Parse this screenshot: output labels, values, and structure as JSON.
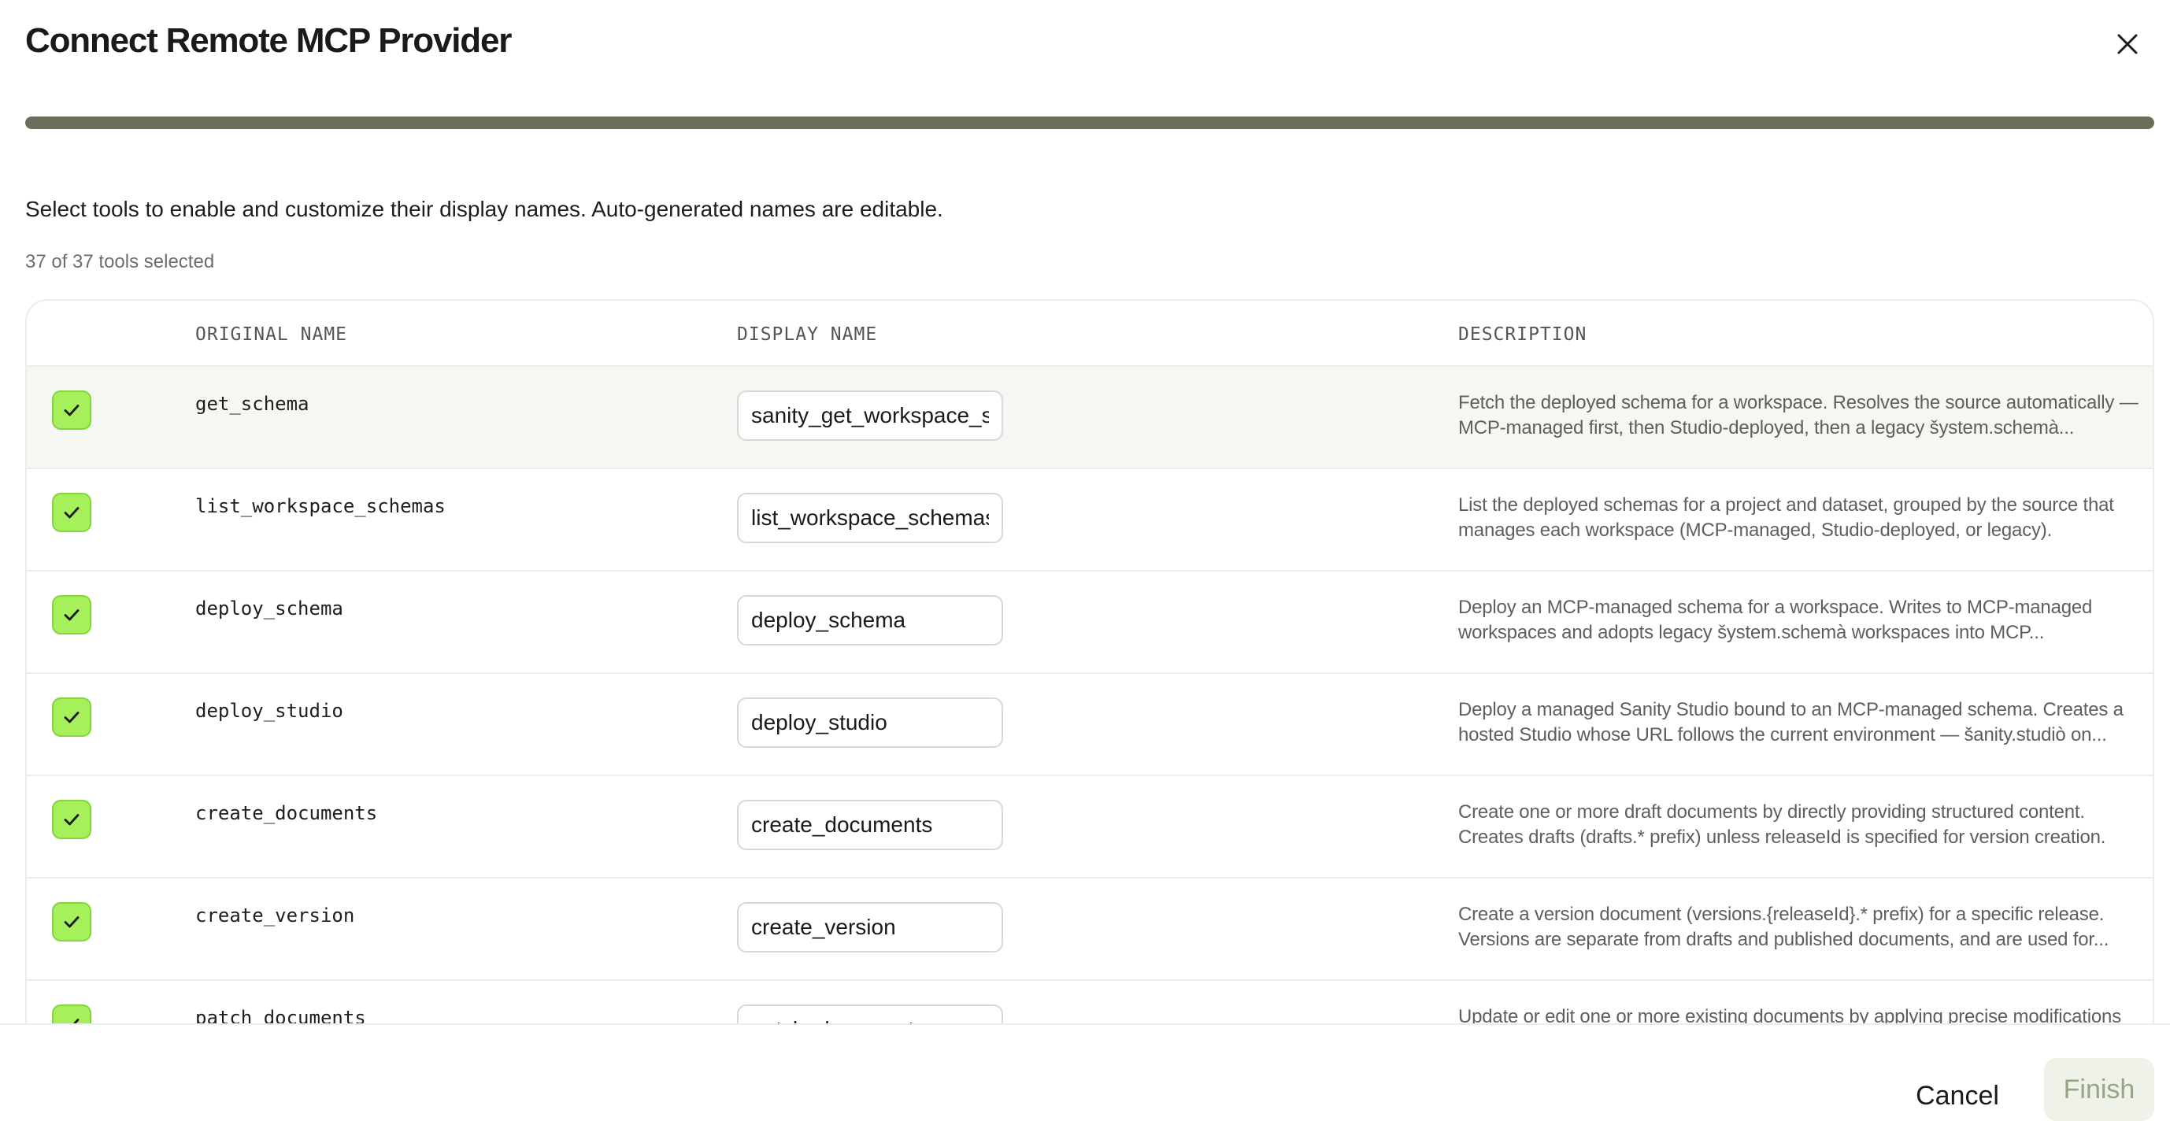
{
  "dialog": {
    "title": "Connect Remote MCP Provider",
    "close_icon": "close-icon",
    "progress_percent": 100,
    "subtitle": "Select tools to enable and customize their display names. Auto-generated names are editable.",
    "count_text": "37 of 37 tools selected"
  },
  "table": {
    "headers": {
      "original": "ORIGINAL NAME",
      "display": "DISPLAY NAME",
      "description": "DESCRIPTION"
    },
    "rows": [
      {
        "original": "get_schema",
        "display": "sanity_get_workspace_schema",
        "description": "Fetch the deployed schema for a workspace. Resolves the source automatically — MCP-managed first, then Studio-deployed, then a legacy šystem.schemà..."
      },
      {
        "original": "list_workspace_schemas",
        "display": "list_workspace_schemas",
        "description": "List the deployed schemas for a project and dataset, grouped by the source that manages each workspace (MCP-managed, Studio-deployed, or legacy)."
      },
      {
        "original": "deploy_schema",
        "display": "deploy_schema",
        "description": "Deploy an MCP-managed schema for a workspace. Writes to MCP-managed workspaces and adopts legacy šystem.schemà workspaces into MCP..."
      },
      {
        "original": "deploy_studio",
        "display": "deploy_studio",
        "description": "Deploy a managed Sanity Studio bound to an MCP-managed schema. Creates a hosted Studio whose URL follows the current environment — šanity.studiò on..."
      },
      {
        "original": "create_documents",
        "display": "create_documents",
        "description": "Create one or more draft documents by directly providing structured content. Creates drafts (drafts.* prefix) unless releaseId is specified for version creation."
      },
      {
        "original": "create_version",
        "display": "create_version",
        "description": "Create a version document (versions.{releaseId}.* prefix) for a specific release. Versions are separate from drafts and published documents, and are used for..."
      },
      {
        "original": "patch_documents",
        "display": "patch_documents",
        "description": "Update or edit one or more existing documents by applying precise modifications"
      }
    ]
  },
  "footer": {
    "cancel_label": "Cancel",
    "finish_label": "Finish"
  },
  "colors": {
    "accent_check": "#a5f05b",
    "progress": "#6a6e5b",
    "finish_disabled_bg": "#eef2e8"
  }
}
